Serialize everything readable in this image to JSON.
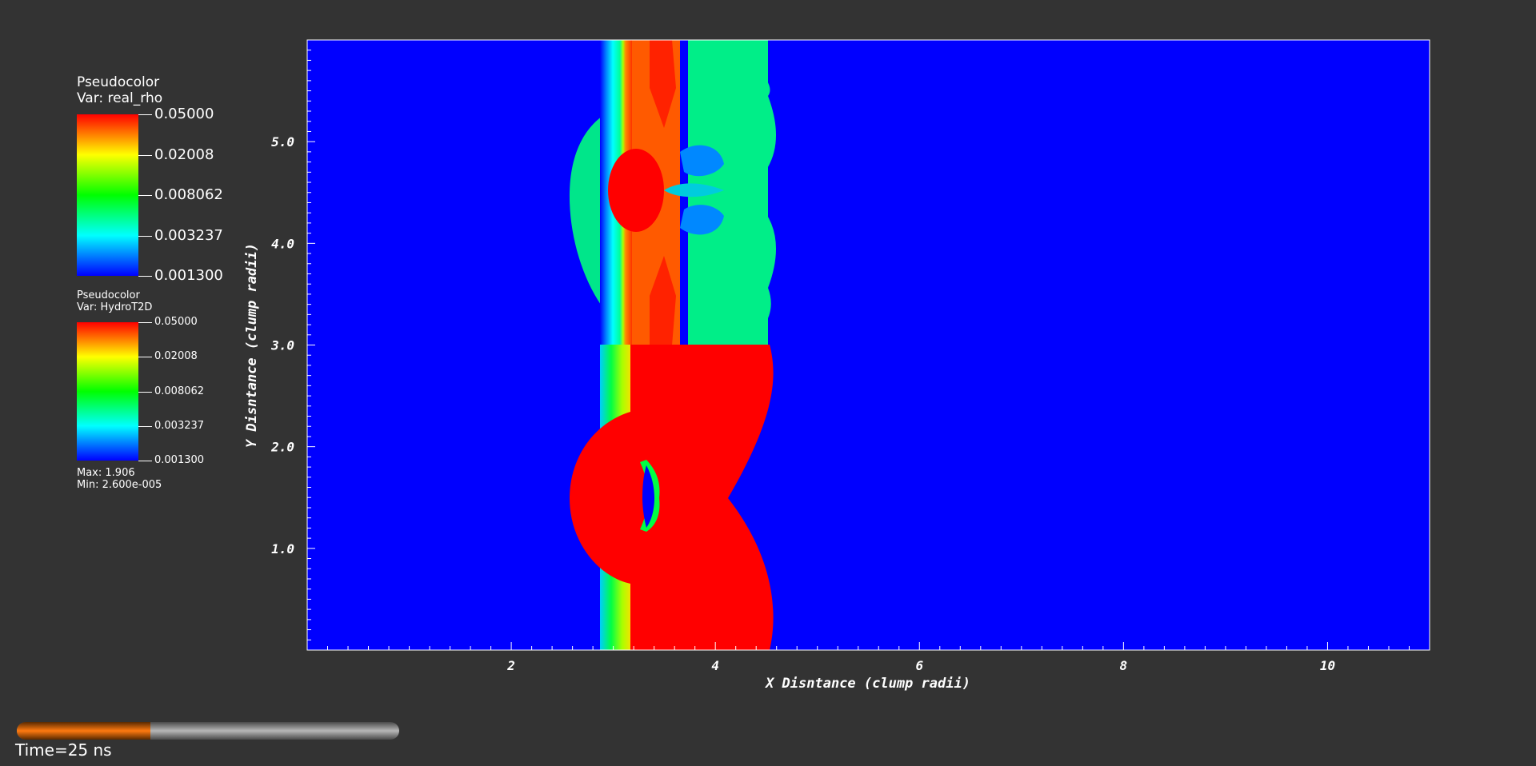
{
  "legends": [
    {
      "title": "Pseudocolor",
      "var_label": "Var: real_rho",
      "ticks": [
        "0.05000",
        "0.02008",
        "0.008062",
        "0.003237",
        "0.001300"
      ],
      "max_label": "",
      "min_label": ""
    },
    {
      "title": "Pseudocolor",
      "var_label": "Var: HydroT2D",
      "ticks": [
        "0.05000",
        "0.02008",
        "0.008062",
        "0.003237",
        "0.001300"
      ],
      "max_label": "Max:  1.906",
      "min_label": "Min:  2.600e-005"
    }
  ],
  "colors": {
    "background": "#333333",
    "colormap": [
      "#ff0000",
      "#ffff00",
      "#00ff00",
      "#00ffff",
      "#0000ff"
    ],
    "field_low": "#0000ff",
    "field_high": "#ff0000",
    "progress_fill": "#ff7a10",
    "progress_track": "#b7b7b7"
  },
  "chart_data": {
    "type": "heatmap",
    "title": "",
    "xlabel": "X Disntance (clump radii)",
    "ylabel": "Y Disntance (clump radii)",
    "xlim": [
      0,
      11
    ],
    "ylim": [
      0,
      6
    ],
    "x_ticks": [
      2,
      4,
      6,
      8,
      10
    ],
    "x_tick_labels": [
      "2",
      "4",
      "6",
      "8",
      "10"
    ],
    "y_ticks": [
      1.0,
      2.0,
      3.0,
      4.0,
      5.0
    ],
    "y_tick_labels": [
      "1.0",
      "2.0",
      "3.0",
      "4.0",
      "5.0"
    ],
    "upper_panel": {
      "variable": "real_rho",
      "y_range": [
        3,
        6
      ]
    },
    "lower_panel": {
      "variable": "HydroT2D",
      "y_range": [
        0,
        3
      ]
    },
    "colormap_scale": "log",
    "colormap_range": [
      0.0013,
      0.05
    ]
  },
  "time_label": "Time=25 ns",
  "progress_fraction": 0.35
}
